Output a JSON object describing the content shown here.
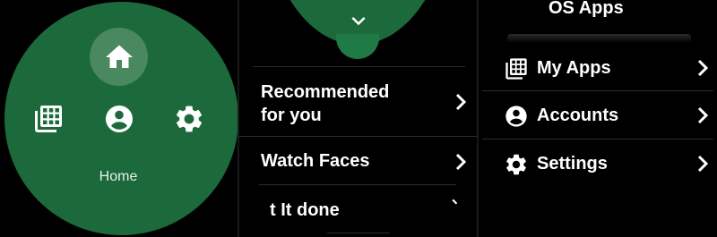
{
  "panel_nav": {
    "home_label": "Home",
    "icons": [
      "home-icon",
      "apps-grid-icon",
      "account-circle-icon",
      "gear-icon"
    ]
  },
  "panel_list": {
    "collapse_icon": "chevron-down-icon",
    "items": [
      {
        "label_line1": "Recommended",
        "label_line2": "for you"
      },
      {
        "label": "Watch Faces"
      },
      {
        "label": "t It done"
      }
    ]
  },
  "panel_menu": {
    "partial_header": "OS Apps",
    "items": [
      {
        "label": "My Apps",
        "icon": "apps-grid-icon"
      },
      {
        "label": "Accounts",
        "icon": "account-circle-icon"
      },
      {
        "label": "Settings",
        "icon": "gear-icon"
      }
    ]
  },
  "colors": {
    "primary_green": "#1c6a3c",
    "highlight_green": "#4a8860",
    "background": "#000000",
    "text": "#ffffff"
  }
}
